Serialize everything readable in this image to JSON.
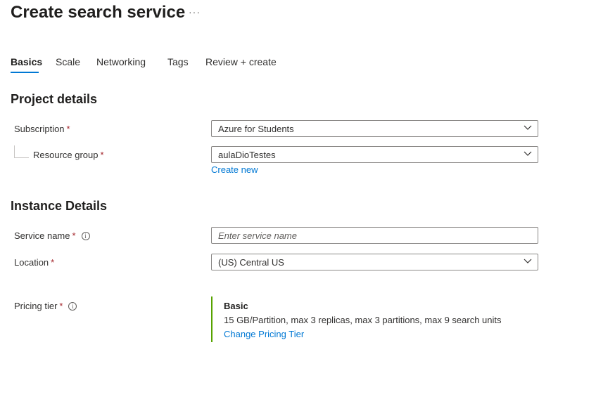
{
  "header": {
    "title": "Create search service",
    "more_label": "···"
  },
  "tabs": [
    {
      "label": "Basics",
      "active": true
    },
    {
      "label": "Scale"
    },
    {
      "label": "Networking"
    },
    {
      "label": "Tags"
    },
    {
      "label": "Review + create"
    }
  ],
  "project_details": {
    "heading": "Project details",
    "subscription": {
      "label": "Subscription",
      "required": "*",
      "value": "Azure for Students"
    },
    "resource_group": {
      "label": "Resource group",
      "required": "*",
      "value": "aulaDioTestes",
      "create_new_label": "Create new"
    }
  },
  "instance_details": {
    "heading": "Instance Details",
    "service_name": {
      "label": "Service name",
      "required": "*",
      "value": "",
      "placeholder": "Enter service name",
      "info_icon": "info-icon"
    },
    "location": {
      "label": "Location",
      "required": "*",
      "value": "(US) Central US"
    }
  },
  "pricing": {
    "label": "Pricing tier",
    "required": "*",
    "tier_name": "Basic",
    "tier_description": "15 GB/Partition, max 3 replicas, max 3 partitions, max 9 search units",
    "change_label": "Change Pricing Tier",
    "accent_color": "#57a300"
  },
  "colors": {
    "accent": "#0078d4",
    "required": "#a4262c"
  }
}
